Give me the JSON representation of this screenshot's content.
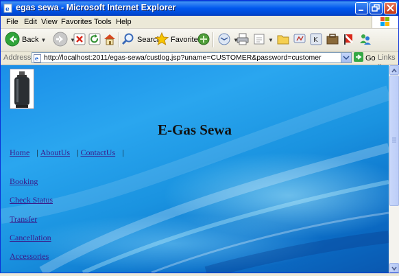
{
  "window": {
    "title": "egas sewa - Microsoft Internet Explorer",
    "accent": "#0058ee"
  },
  "menu": {
    "items": [
      "File",
      "Edit",
      "View",
      "Favorites",
      "Tools",
      "Help"
    ]
  },
  "toolbar": {
    "back_label": "Back",
    "search_label": "Search",
    "favorites_label": "Favorites"
  },
  "address": {
    "label": "Address",
    "url": "http://localhost:2011/egas-sewa/custlog.jsp?uname=CUSTOMER&password=customer",
    "go_label": "Go",
    "links_label": "Links"
  },
  "page": {
    "heading": "E-Gas Sewa",
    "nav": [
      "Home",
      "AboutUs",
      "ContactUs"
    ],
    "nav_separator": "|",
    "side_links": [
      "Booking",
      "Check Status",
      "Transfer",
      "Cancellation",
      "Accessories"
    ],
    "link_color": "#3a1a8a"
  }
}
